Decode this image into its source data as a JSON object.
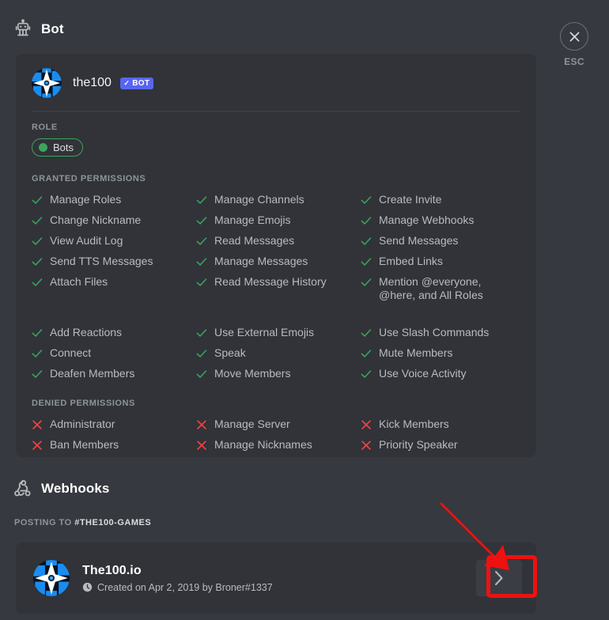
{
  "window": {
    "background": "#36393f",
    "card_background": "#313338"
  },
  "close": {
    "icon": "close-icon",
    "label": "ESC"
  },
  "bot": {
    "section_icon": "robot-icon",
    "section_title": "Bot",
    "name": "the100",
    "badge": {
      "check": "✓",
      "label": "BOT",
      "color": "#5865f2"
    },
    "role_heading": "ROLE",
    "role": {
      "name": "Bots",
      "color": "#3ba55c"
    }
  },
  "permissions": {
    "granted_heading": "GRANTED PERMISSIONS",
    "denied_heading": "DENIED PERMISSIONS",
    "granted_color": "#3ba55c",
    "denied_color": "#ed4245",
    "granted_group_1": [
      "Manage Roles",
      "Manage Channels",
      "Create Invite",
      "Change Nickname",
      "Manage Emojis",
      "Manage Webhooks",
      "View Audit Log",
      "Read Messages",
      "Send Messages",
      "Send TTS Messages",
      "Manage Messages",
      "Embed Links",
      "Attach Files",
      "Read Message History",
      "Mention @everyone, @here, and All Roles"
    ],
    "granted_group_2": [
      "Add Reactions",
      "Use External Emojis",
      "Use Slash Commands",
      "Connect",
      "Speak",
      "Mute Members",
      "Deafen Members",
      "Move Members",
      "Use Voice Activity"
    ],
    "denied": [
      "Administrator",
      "Manage Server",
      "Kick Members",
      "Ban Members",
      "Manage Nicknames",
      "Priority Speaker"
    ]
  },
  "webhooks": {
    "section_icon": "webhook-icon",
    "section_title": "Webhooks",
    "posting_to_label": "POSTING TO",
    "posting_to_channel": "#THE100-GAMES",
    "entry": {
      "name": "The100.io",
      "meta_icon": "clock-icon",
      "meta": "Created on Apr 2, 2019 by Broner#1337",
      "chevron": "chevron-right-icon"
    }
  },
  "annotations": {
    "arrow_color": "#ee1111",
    "box_color": "#ee1111",
    "target": "webhook-chevron-button"
  }
}
